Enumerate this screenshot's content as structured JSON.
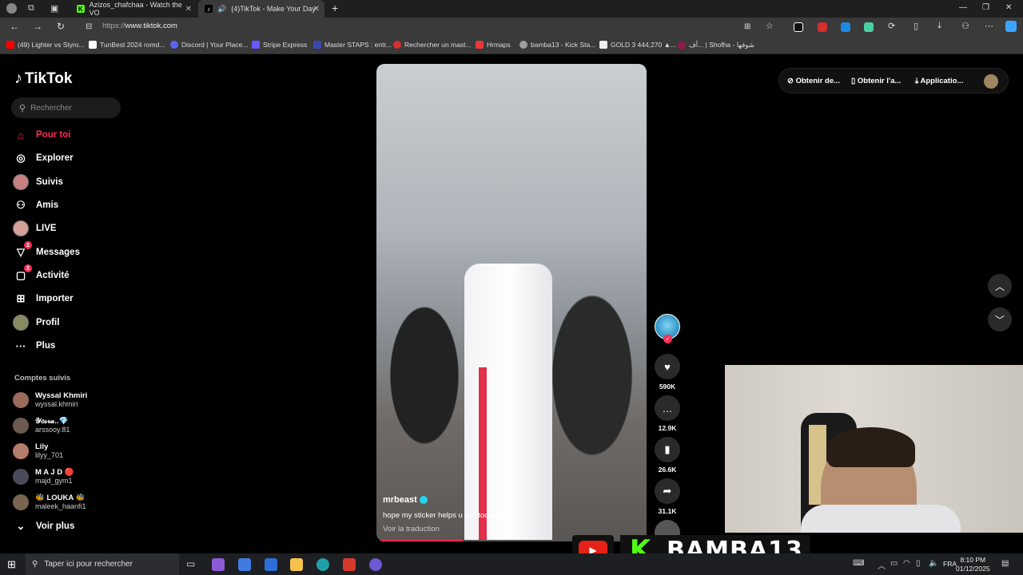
{
  "browser": {
    "tabs": [
      {
        "title": "Azizos_chafchaa - Watch the VO",
        "favicon": "kick-icon",
        "active": false
      },
      {
        "title": "(4)TikTok - Make Your Day",
        "favicon": "tiktok-icon",
        "active": true
      }
    ],
    "new_tab": "+",
    "url_prefix": "https://",
    "url_host": "www.tiktok.com",
    "bookmarks": [
      {
        "label": "(49) Lighter vs Styro...",
        "color": "#ff0000"
      },
      {
        "label": "TunBest 2024 romd...",
        "color": "#ffffff"
      },
      {
        "label": "Discord | Your Place...",
        "color": "#5865f2"
      },
      {
        "label": "Stripe Express",
        "color": "#635bff"
      },
      {
        "label": "Master STAPS : entr...",
        "color": "#3949ab"
      },
      {
        "label": "Rechercher un mast...",
        "color": "#d32f2f"
      },
      {
        "label": "Hrmaps",
        "color": "#e53935"
      },
      {
        "label": "bamba13 - Kick Sta...",
        "color": "#9e9e9e"
      },
      {
        "label": "GOLD 3 444,270 ▲...",
        "color": "#eeeeee"
      },
      {
        "label": "أف... | Shofha - شوفها",
        "color": "#8e1b4b"
      }
    ]
  },
  "tiktok": {
    "logo": "TikTok",
    "search_placeholder": "Rechercher",
    "nav": [
      {
        "label": "Pour toi",
        "icon": "home-icon",
        "active": true
      },
      {
        "label": "Explorer",
        "icon": "compass-icon"
      },
      {
        "label": "Suivis",
        "icon": "avatar-icon"
      },
      {
        "label": "Amis",
        "icon": "friends-icon"
      },
      {
        "label": "LIVE",
        "icon": "live-icon"
      },
      {
        "label": "Messages",
        "icon": "messages-icon",
        "badge": "2"
      },
      {
        "label": "Activité",
        "icon": "activity-icon",
        "badge": "2"
      },
      {
        "label": "Importer",
        "icon": "upload-icon"
      },
      {
        "label": "Profil",
        "icon": "profile-icon"
      },
      {
        "label": "Plus",
        "icon": "more-icon"
      }
    ],
    "following_title": "Comptes suivis",
    "following": [
      {
        "name": "Wyssal Khmiri",
        "handle": "wyssal.khmiri"
      },
      {
        "name": "𝒴𝑜𝓈𝓇𝒶..💎",
        "handle": "arssooy.81"
      },
      {
        "name": "Lily",
        "handle": "lilyy_701"
      },
      {
        "name": "M A J D 🔴",
        "handle": "majd_gym1"
      },
      {
        "name": "🐝 LOUKA 🐝",
        "handle": "maleek_haanfi1"
      }
    ],
    "see_more": "Voir plus",
    "video": {
      "author": "mrbeast",
      "caption": "hope my sticker helps u win today #f1",
      "translate": "Voir la traduction",
      "progress": 0.32
    },
    "actions": [
      {
        "icon": "heart-icon",
        "count": "590K"
      },
      {
        "icon": "comment-icon",
        "count": "12.9K"
      },
      {
        "icon": "bookmark-icon",
        "count": "26.6K"
      },
      {
        "icon": "share-icon",
        "count": "31.1K"
      }
    ],
    "topbar": [
      "Obtenir de...",
      "Obtenir l'a...",
      "Applicatio..."
    ]
  },
  "overlay": {
    "channel": "BAMBA13",
    "kick_letter": "K"
  },
  "taskbar": {
    "search_placeholder": "Taper ici pour rechercher",
    "lang": "FRA",
    "time": "8:10 PM",
    "date": "01/12/2025"
  }
}
